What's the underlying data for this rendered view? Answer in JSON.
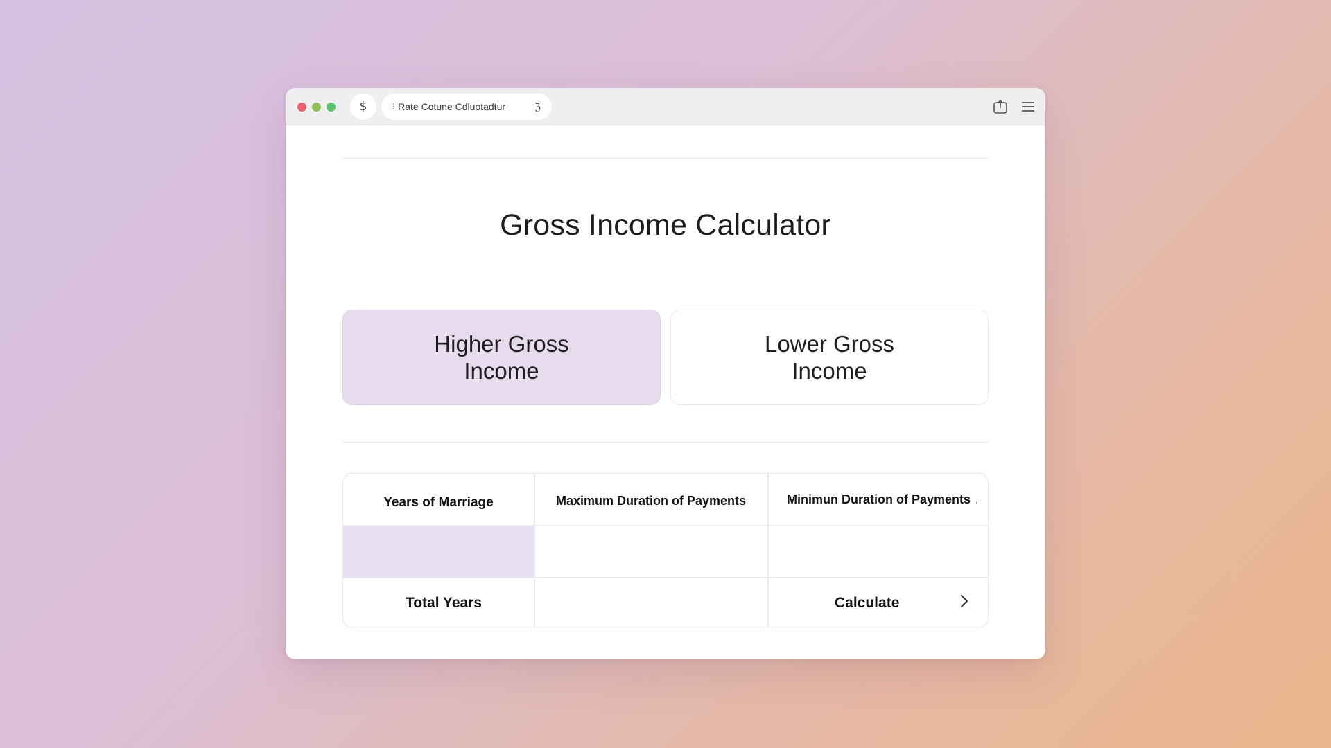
{
  "browser": {
    "tab_grip": "⁝",
    "tab_title": "Rate Cotune Cdluotadtur",
    "tab_close": "ℨ",
    "nav_icon": "dollar-icon",
    "nav_glyph": "$"
  },
  "page": {
    "title": "Gross Income Calculator"
  },
  "options": {
    "higher_label": "Higher Gross Income",
    "lower_label": "Lower Gross Income",
    "selected": "higher"
  },
  "table": {
    "headers": {
      "years": "Years of Marriage",
      "max": "Maximum Duration of Payments",
      "min": "Minimun Duration of Payments",
      "min_mark": ","
    },
    "row": {
      "years": "",
      "max": "",
      "min": ""
    },
    "footer": {
      "total_label": "Total Years",
      "total_value": "",
      "calculate_label": "Calculate"
    }
  },
  "colors": {
    "accent_fill": "#e6dcee",
    "traffic_red": "#ec5f6e",
    "traffic_yellow": "#8fbf55",
    "traffic_green": "#5cc26b"
  }
}
